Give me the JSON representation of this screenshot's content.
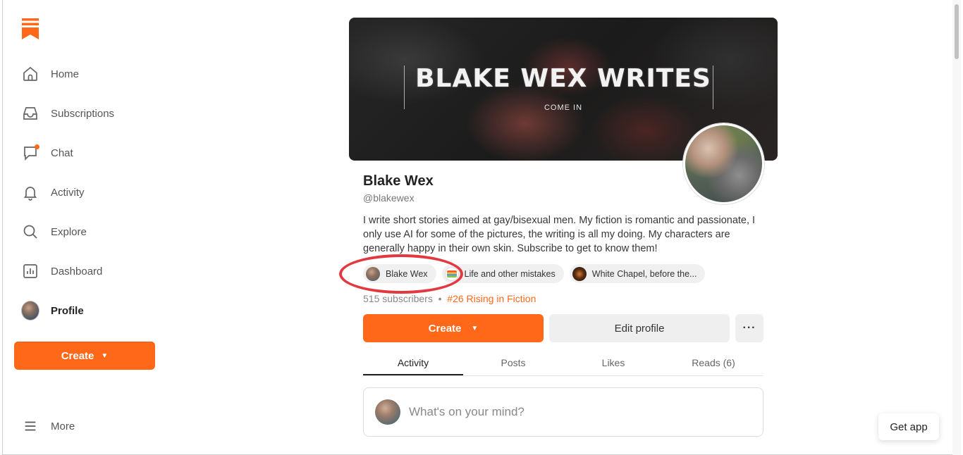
{
  "brand": {
    "accent": "#ff6719",
    "logo_icon": "substack-logo-icon"
  },
  "sidebar": {
    "items": [
      {
        "label": "Home",
        "icon": "home-icon"
      },
      {
        "label": "Subscriptions",
        "icon": "inbox-icon"
      },
      {
        "label": "Chat",
        "icon": "chat-icon"
      },
      {
        "label": "Activity",
        "icon": "bell-icon"
      },
      {
        "label": "Explore",
        "icon": "search-icon"
      },
      {
        "label": "Dashboard",
        "icon": "chart-icon"
      },
      {
        "label": "Profile",
        "icon": "avatar"
      }
    ],
    "create_label": "Create",
    "more_label": "More"
  },
  "banner": {
    "title": "BLAKE WEX WRITES",
    "subtitle": "COME IN"
  },
  "profile": {
    "name": "Blake Wex",
    "handle": "@blakewex",
    "bio": "I write short stories aimed at gay/bisexual men. My fiction is romantic and passionate, I only use AI for some of the pictures, the writing is all my doing. My characters are generally happy in their own skin. Subscribe to get to know them!",
    "publications": [
      {
        "label": "Blake Wex"
      },
      {
        "label": "Life and other mistakes"
      },
      {
        "label": "White Chapel, before the..."
      }
    ],
    "subscribers": "515 subscribers",
    "separator": "•",
    "rank": "#26 Rising in Fiction"
  },
  "actions": {
    "create_label": "Create",
    "edit_label": "Edit profile",
    "more_label": "···"
  },
  "tabs": [
    {
      "label": "Activity"
    },
    {
      "label": "Posts"
    },
    {
      "label": "Likes"
    },
    {
      "label": "Reads (6)"
    }
  ],
  "composer": {
    "placeholder": "What's on your mind?"
  },
  "get_app_label": "Get app"
}
